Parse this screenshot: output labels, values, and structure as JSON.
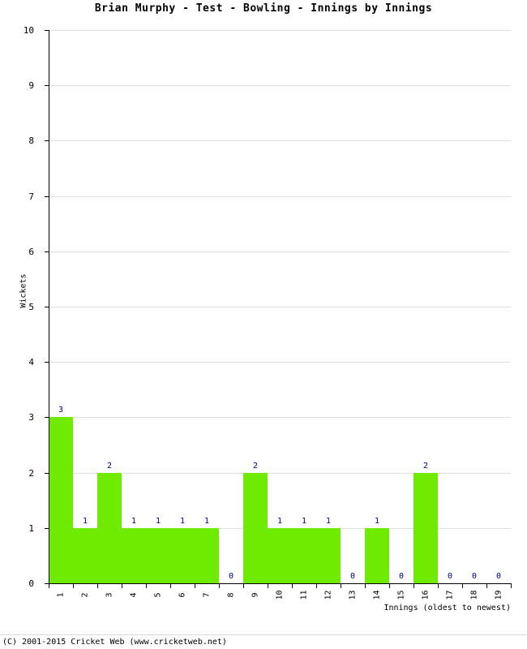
{
  "chart_data": {
    "type": "bar",
    "title": "Brian Murphy - Test - Bowling - Innings by Innings",
    "xlabel": "Innings (oldest to newest)",
    "ylabel": "Wickets",
    "categories": [
      "1",
      "2",
      "3",
      "4",
      "5",
      "6",
      "7",
      "8",
      "9",
      "10",
      "11",
      "12",
      "13",
      "14",
      "15",
      "16",
      "17",
      "18",
      "19"
    ],
    "values": [
      3,
      1,
      2,
      1,
      1,
      1,
      1,
      0,
      2,
      1,
      1,
      1,
      0,
      1,
      0,
      2,
      0,
      0,
      0
    ],
    "value_labels": [
      "3",
      "1",
      "2",
      "1",
      "1",
      "1",
      "1",
      "0",
      "2",
      "1",
      "1",
      "1",
      "0",
      "1",
      "0",
      "2",
      "0",
      "0",
      "0"
    ],
    "ylim": [
      0,
      10
    ],
    "ytick_labels": [
      "0",
      "1",
      "2",
      "3",
      "4",
      "5",
      "6",
      "7",
      "8",
      "9",
      "10"
    ],
    "ytick_values": [
      0,
      1,
      2,
      3,
      4,
      5,
      6,
      7,
      8,
      9,
      10
    ],
    "grid": true,
    "legend": false,
    "bar_color": "#6eeb00",
    "label_color": "#000080",
    "grid_color": "#e0e0e0",
    "axis_color": "#000000"
  },
  "footer": {
    "copyright": "(C) 2001-2015 Cricket Web (www.cricketweb.net)"
  }
}
